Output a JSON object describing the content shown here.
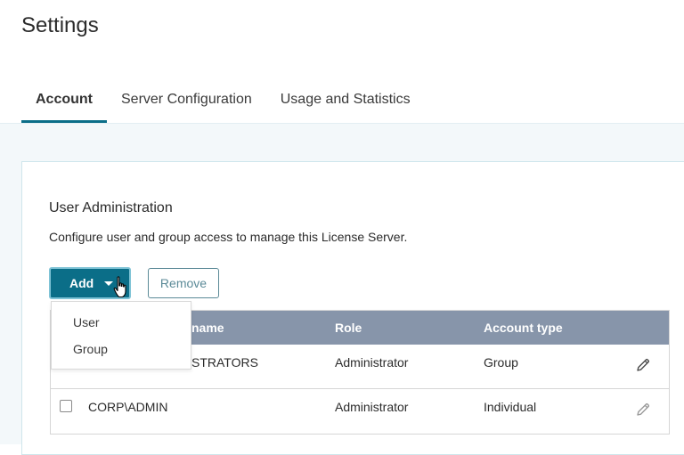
{
  "page": {
    "title": "Settings"
  },
  "tabs": [
    {
      "label": "Account",
      "active": true
    },
    {
      "label": "Server Configuration",
      "active": false
    },
    {
      "label": "Usage and Statistics",
      "active": false
    }
  ],
  "section": {
    "title": "User Administration",
    "description": "Configure user and group access to manage this License Server."
  },
  "toolbar": {
    "add_label": "Add",
    "remove_label": "Remove"
  },
  "add_menu": {
    "items": [
      "User",
      "Group"
    ]
  },
  "table": {
    "columns": [
      "name",
      "Role",
      "Account type"
    ],
    "rows": [
      {
        "name": "STRATORS",
        "role": "Administrator",
        "account_type": "Group"
      },
      {
        "name": "CORP\\ADMIN",
        "role": "Administrator",
        "account_type": "Individual"
      }
    ]
  },
  "colors": {
    "accent": "#0b6e88",
    "header_bg": "#8795aa",
    "content_bg": "#f3f8fa"
  },
  "icons": {
    "add_caret": "chevron-down-icon",
    "cursor": "hand-pointer-icon",
    "row_edit": "pencil-icon"
  }
}
